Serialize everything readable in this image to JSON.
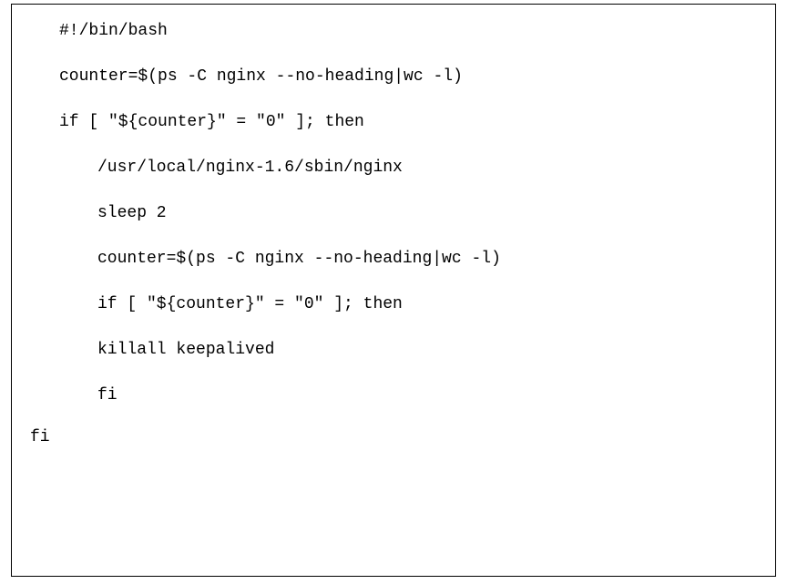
{
  "code": {
    "line1": "#!/bin/bash",
    "line2": "counter=$(ps -C nginx --no-heading|wc -l)",
    "line3": "if [ \"${counter}\" = \"0\" ]; then",
    "line4": "/usr/local/nginx-1.6/sbin/nginx",
    "line5": "sleep 2",
    "line6": "counter=$(ps -C nginx --no-heading|wc -l)",
    "line7": "if [ \"${counter}\" = \"0\" ]; then",
    "line8": "killall keepalived",
    "line9": "fi",
    "line10": "fi"
  }
}
